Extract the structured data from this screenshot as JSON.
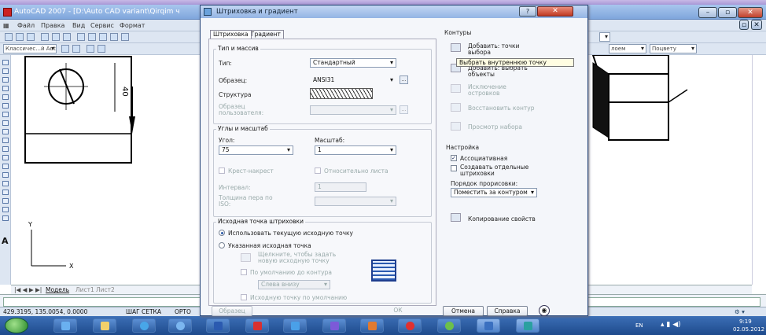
{
  "acad": {
    "title": "AutoCAD 2007 - [D:\\Auto CAD variant\\Qirqim ч",
    "menu": [
      "Файл",
      "Правка",
      "Вид",
      "Сервис",
      "Формат"
    ],
    "layer_combo": "Классичес...й AutoCAD",
    "right_combo_1": "лоем",
    "right_combo_2": "Поцвету",
    "tabs": {
      "model": "Модель",
      "layout1": "Лист1",
      "layout2": "Лист2"
    },
    "status": {
      "coords": "429.3195, 135.0054, 0.0000",
      "snap": "ШАГ",
      "grid": "СЕТКА",
      "ortho": "ОРТО"
    },
    "drawing": {
      "dimension": "40",
      "axis_y": "Y",
      "axis_x": "X",
      "ucs_label": "A"
    }
  },
  "dialog": {
    "title": "Штриховка и градиент",
    "help_btn": "?",
    "close_btn": "✕",
    "tabs": [
      "Штриховка",
      "Градиент"
    ],
    "group_type": "Тип и массив",
    "type_label": "Тип:",
    "type_value": "Стандартный",
    "pattern_label": "Образец:",
    "pattern_value": "ANSI31",
    "swatch_label": "Структура",
    "custom_label": "Образец пользователя:",
    "group_angle": "Углы и масштаб",
    "angle_label": "Угол:",
    "angle_value": "75",
    "scale_label": "Масштаб:",
    "scale_value": "1",
    "double_label": "Крест-накрест",
    "relative_label": "Относительно листа",
    "spacing_label": "Интервал:",
    "spacing_value": "1",
    "iso_label": "Толщина пера по ISO:",
    "group_origin": "Исходная точка штриховки",
    "use_current": "Использовать текущую исходную точку",
    "specified": "Указанная исходная точка",
    "click_set": "Щелкните, чтобы задать новую исходную точку",
    "default_ext": "По умолчанию до контура",
    "position_value": "Слева внизу",
    "store_default": "Исходную точку по умолчанию",
    "contours": "Контуры",
    "add_pick": "Добавить: точки выбора",
    "tooltip": "Выбрать внутреннюю точку",
    "add_select": "Добавить: выбрать объекты",
    "remove_bound": "Исключение островков",
    "recreate": "Восстановить контур",
    "view_sel": "Просмотр набора",
    "settings": "Настройка",
    "associative": "Ассоциативная",
    "separate": "Создавать отдельные штриховки",
    "draw_order_label": "Порядок прорисовки:",
    "draw_order_value": "Поместить за контуром",
    "inherit": "Копирование свойств",
    "preview_btn": "Образец",
    "ok_btn": "ОК",
    "cancel_btn": "Отмена",
    "help_btn2": "Справка"
  },
  "tray": {
    "lang": "EN",
    "time": "9:19",
    "date": "02.05.2012"
  }
}
